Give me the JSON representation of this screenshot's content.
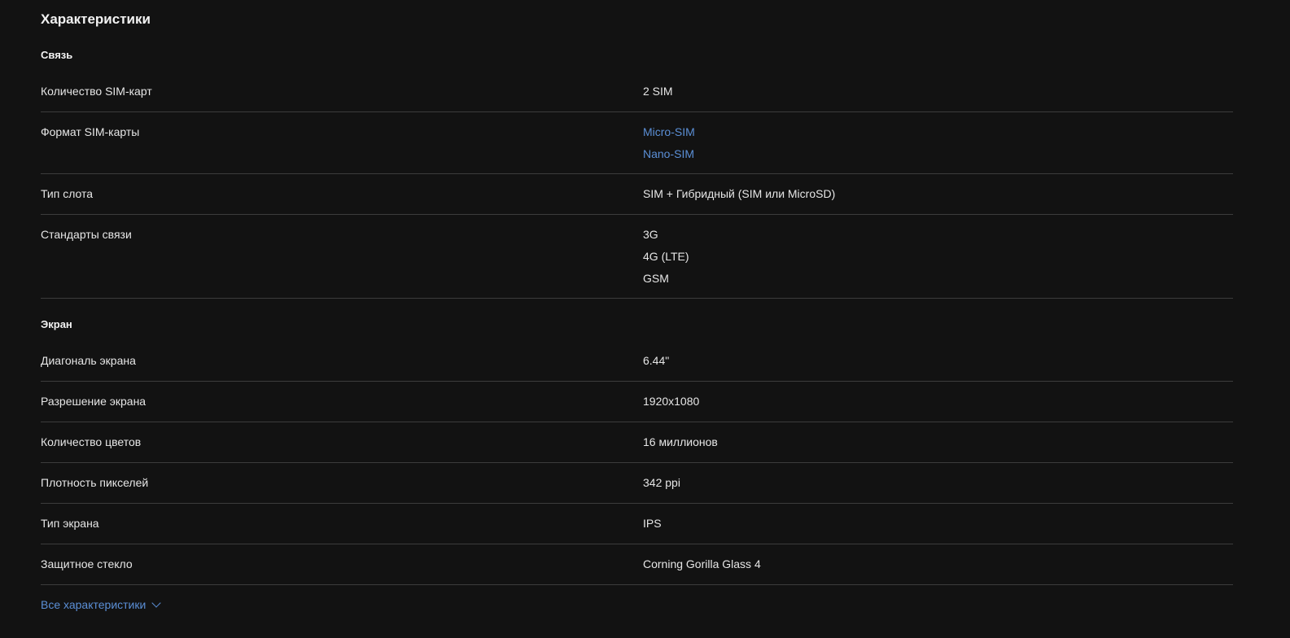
{
  "title": "Характеристики",
  "sections": [
    {
      "name": "Связь",
      "rows": [
        {
          "label": "Количество SIM-карт",
          "values": [
            {
              "text": "2 SIM",
              "link": false
            }
          ]
        },
        {
          "label": "Формат SIM-карты",
          "values": [
            {
              "text": "Micro-SIM",
              "link": true
            },
            {
              "text": "Nano-SIM",
              "link": true
            }
          ]
        },
        {
          "label": "Тип слота",
          "values": [
            {
              "text": "SIM + Гибридный (SIM или MicroSD)",
              "link": false
            }
          ]
        },
        {
          "label": "Стандарты связи",
          "values": [
            {
              "text": "3G",
              "link": false
            },
            {
              "text": "4G (LTE)",
              "link": false
            },
            {
              "text": "GSM",
              "link": false
            }
          ]
        }
      ]
    },
    {
      "name": "Экран",
      "rows": [
        {
          "label": "Диагональ экрана",
          "values": [
            {
              "text": "6.44\"",
              "link": false
            }
          ]
        },
        {
          "label": "Разрешение экрана",
          "values": [
            {
              "text": "1920x1080",
              "link": false
            }
          ]
        },
        {
          "label": "Количество цветов",
          "values": [
            {
              "text": "16 миллионов",
              "link": false
            }
          ]
        },
        {
          "label": "Плотность пикселей",
          "values": [
            {
              "text": "342 ppi",
              "link": false
            }
          ]
        },
        {
          "label": "Тип экрана",
          "values": [
            {
              "text": "IPS",
              "link": false
            }
          ]
        },
        {
          "label": "Защитное стекло",
          "values": [
            {
              "text": "Corning Gorilla Glass 4",
              "link": false
            }
          ]
        }
      ]
    }
  ],
  "all_specs_link": {
    "label": "Все характеристики",
    "icon": "chevron-down-icon"
  },
  "colors": {
    "background": "#121212",
    "text": "#e6e6e6",
    "link": "#5b8fd6",
    "divider": "#3c3c3c"
  }
}
